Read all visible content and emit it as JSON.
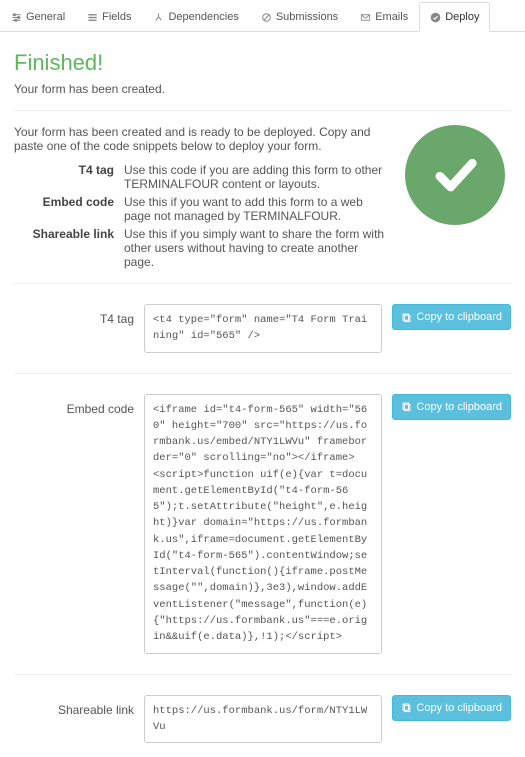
{
  "tabs": {
    "general": "General",
    "fields": "Fields",
    "dependencies": "Dependencies",
    "submissions": "Submissions",
    "emails": "Emails",
    "deploy": "Deploy"
  },
  "heading": "Finished!",
  "subheading": "Your form has been created.",
  "intro": "Your form has been created and is ready to be deployed. Copy and paste one of the code snippets below to deploy your form.",
  "descriptions": {
    "t4tag": {
      "label": "T4 tag",
      "text": "Use this code if you are adding this form to other TERMINALFOUR content or layouts."
    },
    "embed": {
      "label": "Embed code",
      "text": "Use this if you want to add this form to a web page not managed by TERMINALFOUR."
    },
    "share": {
      "label": "Shareable link",
      "text": "Use this if you simply want to share the form with other users without having to create another page."
    }
  },
  "snippets": {
    "t4tag": {
      "label": "T4 tag",
      "code": "<t4 type=\"form\" name=\"T4 Form Training\" id=\"565\" />"
    },
    "embed": {
      "label": "Embed code",
      "code": "<iframe id=\"t4-form-565\" width=\"560\" height=\"700\" src=\"https://us.formbank.us/embed/NTY1LWVu\" frameborder=\"0\" scrolling=\"no\"></iframe>\n<script>function uif(e){var t=document.getElementById(\"t4-form-565\");t.setAttribute(\"height\",e.height)}var domain=\"https://us.formbank.us\",iframe=document.getElementById(\"t4-form-565\").contentWindow;setInterval(function(){iframe.postMessage(\"\",domain)},3e3),window.addEventListener(\"message\",function(e){\"https://us.formbank.us\"===e.origin&&uif(e.data)},!1);</script>"
    },
    "share": {
      "label": "Shareable link",
      "code": "https://us.formbank.us/form/NTY1LWVu"
    }
  },
  "copy_label": "Copy to clipboard"
}
